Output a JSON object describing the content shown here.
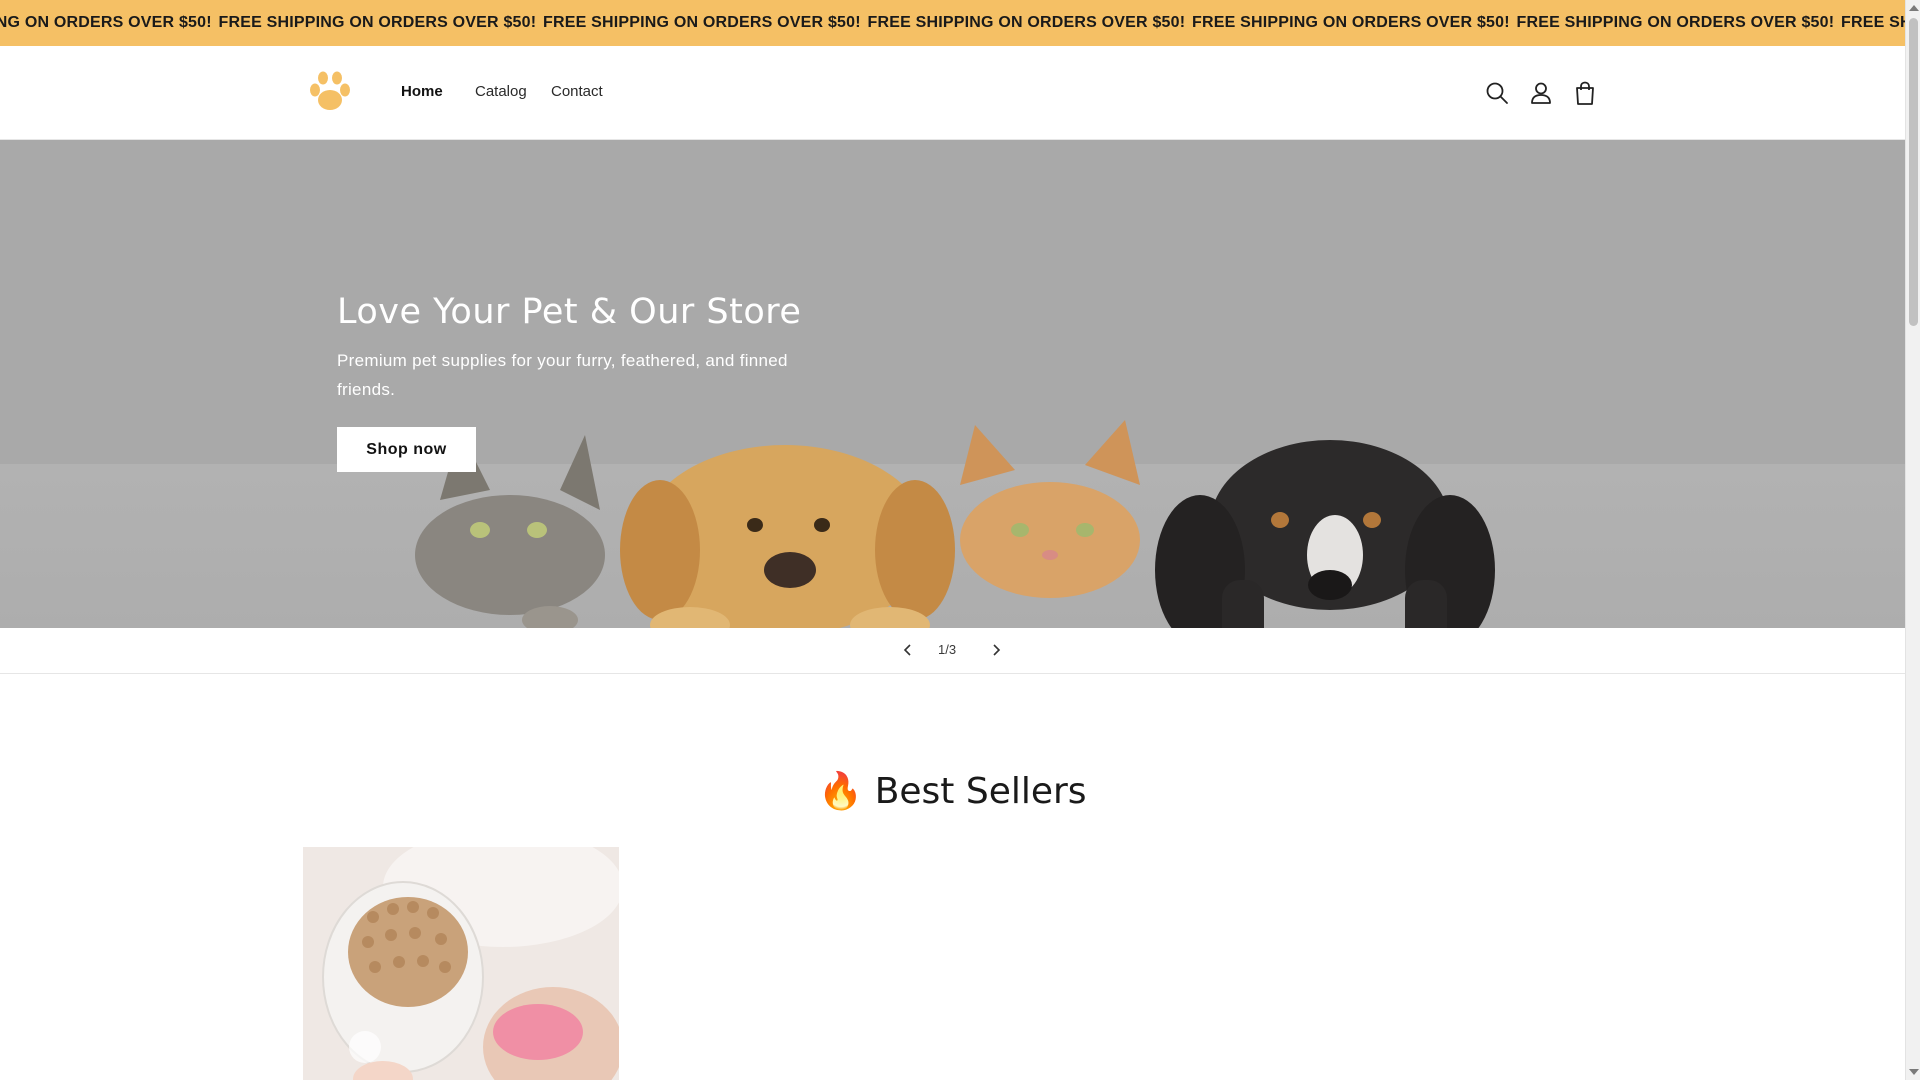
{
  "announcement": {
    "messages": [
      "FREE SHIPPING ON ORDERS OVER $50!",
      "FREE SHIPPING ON ORDERS OVER $50!",
      "FREE SHIPPING ON ORDERS OVER $50!",
      "FREE SHIPPING ON ORDERS OVER $50!",
      "FREE SHIPPING ON ORDERS OVER $50!",
      "FREE SHIPPING ON ORDERS OVER $50!",
      "FREE SHIPPING ON ORDERS OVER $50!"
    ]
  },
  "header": {
    "logo_icon": "paw-print-icon",
    "nav": [
      {
        "label": "Home"
      },
      {
        "label": "Catalog"
      },
      {
        "label": "Contact"
      }
    ],
    "icons": [
      "search-icon",
      "account-icon",
      "cart-icon"
    ]
  },
  "hero": {
    "title": "Love Your Pet & Our Store",
    "subtitle": "Premium pet supplies for your furry, feathered, and finned friends.",
    "button_label": "Shop now"
  },
  "slider": {
    "counter": "1/3",
    "prev_icon": "chevron-left-icon",
    "next_icon": "chevron-right-icon"
  },
  "best_sellers": {
    "title": "🔥 Best Sellers"
  },
  "colors": {
    "announcement_bg": "#f5c065",
    "logo": "#f5c065",
    "hero_bg": "#a9a9a9"
  }
}
